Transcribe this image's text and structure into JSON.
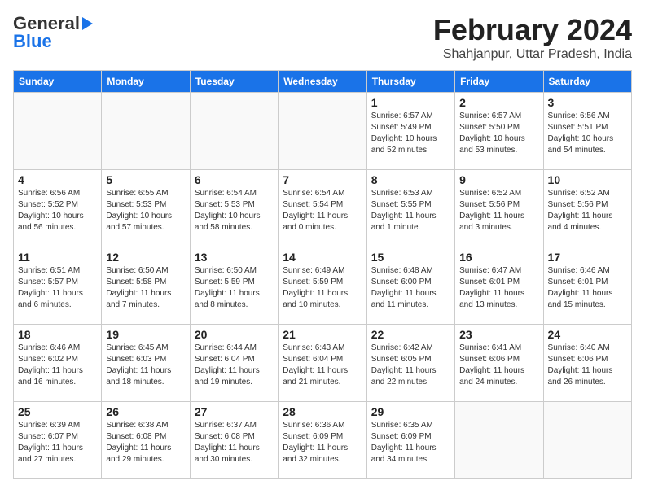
{
  "logo": {
    "general": "General",
    "blue": "Blue"
  },
  "header": {
    "title": "February 2024",
    "subtitle": "Shahjanpur, Uttar Pradesh, India"
  },
  "weekdays": [
    "Sunday",
    "Monday",
    "Tuesday",
    "Wednesday",
    "Thursday",
    "Friday",
    "Saturday"
  ],
  "weeks": [
    [
      {
        "day": "",
        "info": ""
      },
      {
        "day": "",
        "info": ""
      },
      {
        "day": "",
        "info": ""
      },
      {
        "day": "",
        "info": ""
      },
      {
        "day": "1",
        "info": "Sunrise: 6:57 AM\nSunset: 5:49 PM\nDaylight: 10 hours\nand 52 minutes."
      },
      {
        "day": "2",
        "info": "Sunrise: 6:57 AM\nSunset: 5:50 PM\nDaylight: 10 hours\nand 53 minutes."
      },
      {
        "day": "3",
        "info": "Sunrise: 6:56 AM\nSunset: 5:51 PM\nDaylight: 10 hours\nand 54 minutes."
      }
    ],
    [
      {
        "day": "4",
        "info": "Sunrise: 6:56 AM\nSunset: 5:52 PM\nDaylight: 10 hours\nand 56 minutes."
      },
      {
        "day": "5",
        "info": "Sunrise: 6:55 AM\nSunset: 5:53 PM\nDaylight: 10 hours\nand 57 minutes."
      },
      {
        "day": "6",
        "info": "Sunrise: 6:54 AM\nSunset: 5:53 PM\nDaylight: 10 hours\nand 58 minutes."
      },
      {
        "day": "7",
        "info": "Sunrise: 6:54 AM\nSunset: 5:54 PM\nDaylight: 11 hours\nand 0 minutes."
      },
      {
        "day": "8",
        "info": "Sunrise: 6:53 AM\nSunset: 5:55 PM\nDaylight: 11 hours\nand 1 minute."
      },
      {
        "day": "9",
        "info": "Sunrise: 6:52 AM\nSunset: 5:56 PM\nDaylight: 11 hours\nand 3 minutes."
      },
      {
        "day": "10",
        "info": "Sunrise: 6:52 AM\nSunset: 5:56 PM\nDaylight: 11 hours\nand 4 minutes."
      }
    ],
    [
      {
        "day": "11",
        "info": "Sunrise: 6:51 AM\nSunset: 5:57 PM\nDaylight: 11 hours\nand 6 minutes."
      },
      {
        "day": "12",
        "info": "Sunrise: 6:50 AM\nSunset: 5:58 PM\nDaylight: 11 hours\nand 7 minutes."
      },
      {
        "day": "13",
        "info": "Sunrise: 6:50 AM\nSunset: 5:59 PM\nDaylight: 11 hours\nand 8 minutes."
      },
      {
        "day": "14",
        "info": "Sunrise: 6:49 AM\nSunset: 5:59 PM\nDaylight: 11 hours\nand 10 minutes."
      },
      {
        "day": "15",
        "info": "Sunrise: 6:48 AM\nSunset: 6:00 PM\nDaylight: 11 hours\nand 11 minutes."
      },
      {
        "day": "16",
        "info": "Sunrise: 6:47 AM\nSunset: 6:01 PM\nDaylight: 11 hours\nand 13 minutes."
      },
      {
        "day": "17",
        "info": "Sunrise: 6:46 AM\nSunset: 6:01 PM\nDaylight: 11 hours\nand 15 minutes."
      }
    ],
    [
      {
        "day": "18",
        "info": "Sunrise: 6:46 AM\nSunset: 6:02 PM\nDaylight: 11 hours\nand 16 minutes."
      },
      {
        "day": "19",
        "info": "Sunrise: 6:45 AM\nSunset: 6:03 PM\nDaylight: 11 hours\nand 18 minutes."
      },
      {
        "day": "20",
        "info": "Sunrise: 6:44 AM\nSunset: 6:04 PM\nDaylight: 11 hours\nand 19 minutes."
      },
      {
        "day": "21",
        "info": "Sunrise: 6:43 AM\nSunset: 6:04 PM\nDaylight: 11 hours\nand 21 minutes."
      },
      {
        "day": "22",
        "info": "Sunrise: 6:42 AM\nSunset: 6:05 PM\nDaylight: 11 hours\nand 22 minutes."
      },
      {
        "day": "23",
        "info": "Sunrise: 6:41 AM\nSunset: 6:06 PM\nDaylight: 11 hours\nand 24 minutes."
      },
      {
        "day": "24",
        "info": "Sunrise: 6:40 AM\nSunset: 6:06 PM\nDaylight: 11 hours\nand 26 minutes."
      }
    ],
    [
      {
        "day": "25",
        "info": "Sunrise: 6:39 AM\nSunset: 6:07 PM\nDaylight: 11 hours\nand 27 minutes."
      },
      {
        "day": "26",
        "info": "Sunrise: 6:38 AM\nSunset: 6:08 PM\nDaylight: 11 hours\nand 29 minutes."
      },
      {
        "day": "27",
        "info": "Sunrise: 6:37 AM\nSunset: 6:08 PM\nDaylight: 11 hours\nand 30 minutes."
      },
      {
        "day": "28",
        "info": "Sunrise: 6:36 AM\nSunset: 6:09 PM\nDaylight: 11 hours\nand 32 minutes."
      },
      {
        "day": "29",
        "info": "Sunrise: 6:35 AM\nSunset: 6:09 PM\nDaylight: 11 hours\nand 34 minutes."
      },
      {
        "day": "",
        "info": ""
      },
      {
        "day": "",
        "info": ""
      }
    ]
  ]
}
